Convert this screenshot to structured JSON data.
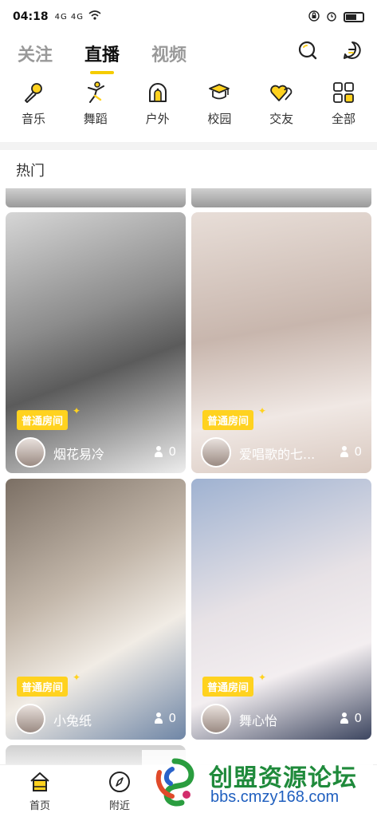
{
  "status_bar": {
    "time": "04:18",
    "signal": "4G 4G"
  },
  "top_tabs": [
    {
      "label": "关注"
    },
    {
      "label": "直播",
      "active": true
    },
    {
      "label": "视频"
    }
  ],
  "categories": [
    {
      "label": "音乐",
      "icon": "microphone-icon"
    },
    {
      "label": "舞蹈",
      "icon": "dancer-icon"
    },
    {
      "label": "户外",
      "icon": "tent-icon"
    },
    {
      "label": "校园",
      "icon": "graduation-cap-icon"
    },
    {
      "label": "交友",
      "icon": "hearts-icon"
    },
    {
      "label": "全部",
      "icon": "grid-icon"
    }
  ],
  "section": {
    "title": "热门"
  },
  "cards": [
    {
      "badge": "普通房间",
      "name": "烟花易冷",
      "viewers": "0"
    },
    {
      "badge": "普通房间",
      "name": "爱唱歌的七...",
      "viewers": "0"
    },
    {
      "badge": "普通房间",
      "name": "小兔纸",
      "viewers": "0"
    },
    {
      "badge": "普通房间",
      "name": "舞心怡",
      "viewers": "0"
    }
  ],
  "bottom_nav": [
    {
      "label": "首页",
      "icon": "home-icon"
    },
    {
      "label": "附近",
      "icon": "compass-icon"
    }
  ],
  "watermark": {
    "title": "创盟资源论坛",
    "url": "bbs.cmzy168.com"
  },
  "colors": {
    "accent": "#ffd21f",
    "text": "#222222",
    "muted": "#999999"
  }
}
